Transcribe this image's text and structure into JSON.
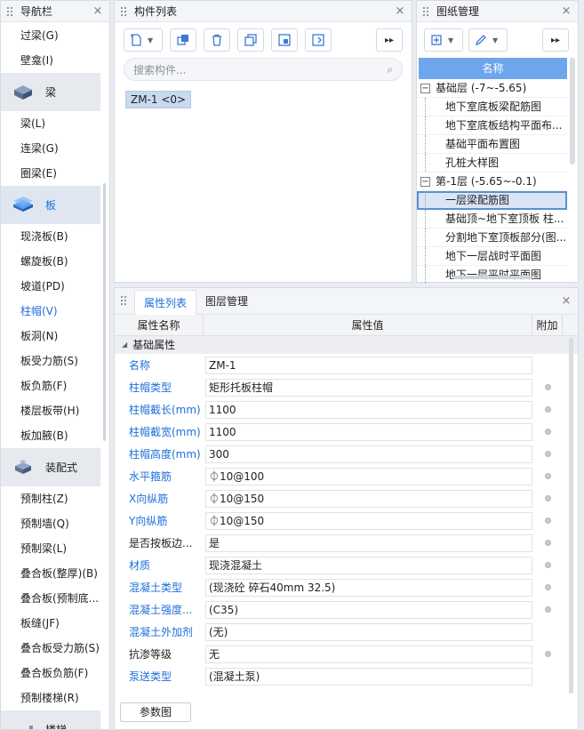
{
  "nav": {
    "title": "导航栏",
    "close": "×",
    "items": [
      {
        "kind": "item",
        "label": "过梁(G)"
      },
      {
        "kind": "item",
        "label": "壁龛(I)"
      },
      {
        "kind": "cat",
        "label": "梁",
        "icon": "beam-icon"
      },
      {
        "kind": "item",
        "label": "梁(L)"
      },
      {
        "kind": "item",
        "label": "连梁(G)"
      },
      {
        "kind": "item",
        "label": "圈梁(E)"
      },
      {
        "kind": "cat",
        "label": "板",
        "icon": "slab-icon",
        "selected": true
      },
      {
        "kind": "item",
        "label": "现浇板(B)"
      },
      {
        "kind": "item",
        "label": "螺旋板(B)"
      },
      {
        "kind": "item",
        "label": "坡道(PD)"
      },
      {
        "kind": "item",
        "label": "柱帽(V)",
        "active": true
      },
      {
        "kind": "item",
        "label": "板洞(N)"
      },
      {
        "kind": "item",
        "label": "板受力筋(S)"
      },
      {
        "kind": "item",
        "label": "板负筋(F)"
      },
      {
        "kind": "item",
        "label": "楼层板带(H)"
      },
      {
        "kind": "item",
        "label": "板加腋(B)"
      },
      {
        "kind": "cat",
        "label": "装配式",
        "icon": "prefab-icon"
      },
      {
        "kind": "item",
        "label": "预制柱(Z)"
      },
      {
        "kind": "item",
        "label": "预制墙(Q)"
      },
      {
        "kind": "item",
        "label": "预制梁(L)"
      },
      {
        "kind": "item",
        "label": "叠合板(整厚)(B)"
      },
      {
        "kind": "item",
        "label": "叠合板(预制底..."
      },
      {
        "kind": "item",
        "label": "板缝(JF)"
      },
      {
        "kind": "item",
        "label": "叠合板受力筋(S)"
      },
      {
        "kind": "item",
        "label": "叠合板负筋(F)"
      },
      {
        "kind": "item",
        "label": "预制楼梯(R)"
      },
      {
        "kind": "cat",
        "label": "楼梯",
        "icon": "stairs-icon"
      }
    ]
  },
  "complist": {
    "title": "构件列表",
    "close": "×",
    "search_placeholder": "搜索构件...",
    "more": "▸▸",
    "component": "ZM-1 <0>"
  },
  "drawings": {
    "title": "图纸管理",
    "close": "×",
    "more": "▸▸",
    "column_header": "名称",
    "rows": [
      {
        "type": "group",
        "label": "基础层 (-7~-5.65)",
        "toggle": "−"
      },
      {
        "type": "child",
        "label": "地下室底板梁配筋图"
      },
      {
        "type": "child",
        "label": "地下室底板结构平面布..."
      },
      {
        "type": "child",
        "label": "基础平面布置图"
      },
      {
        "type": "child",
        "label": "孔桩大样图"
      },
      {
        "type": "group",
        "label": "第-1层 (-5.65~-0.1)",
        "toggle": "−"
      },
      {
        "type": "child",
        "label": "一层梁配筋图",
        "selected": true
      },
      {
        "type": "child",
        "label": "基础顶~地下室顶板 柱..."
      },
      {
        "type": "child",
        "label": "分割地下室顶板部分(图..."
      },
      {
        "type": "child",
        "label": "地下一层战时平面图"
      },
      {
        "type": "child",
        "label": "地下一层平时平面图"
      }
    ]
  },
  "props": {
    "tabs": [
      "属性列表",
      "图层管理"
    ],
    "close": "×",
    "headers": {
      "name": "属性名称",
      "value": "属性值",
      "add": "附加"
    },
    "section": "基础属性",
    "rows": [
      {
        "name": "名称",
        "value": "ZM-1",
        "blue": true,
        "dot": false
      },
      {
        "name": "柱帽类型",
        "value": "矩形托板柱帽",
        "blue": true,
        "dot": true
      },
      {
        "name": "柱帽截长(mm)",
        "value": "1100",
        "blue": true,
        "dot": true
      },
      {
        "name": "柱帽截宽(mm)",
        "value": "1100",
        "blue": true,
        "dot": true
      },
      {
        "name": "柱帽高度(mm)",
        "value": "300",
        "blue": true,
        "dot": true
      },
      {
        "name": "水平箍筋",
        "value": "⏀10@100",
        "blue": true,
        "dot": true
      },
      {
        "name": "X向纵筋",
        "value": "⏀10@150",
        "blue": true,
        "dot": true
      },
      {
        "name": "Y向纵筋",
        "value": "⏀10@150",
        "blue": true,
        "dot": true
      },
      {
        "name": "是否按板边...",
        "value": "是",
        "blue": false,
        "dot": true
      },
      {
        "name": "材质",
        "value": "现浇混凝土",
        "blue": true,
        "dot": true
      },
      {
        "name": "混凝土类型",
        "value": "(现浇砼 碎石40mm 32.5)",
        "blue": true,
        "dot": true
      },
      {
        "name": "混凝土强度...",
        "value": "(C35)",
        "blue": true,
        "dot": true
      },
      {
        "name": "混凝土外加剂",
        "value": "(无)",
        "blue": true,
        "dot": false
      },
      {
        "name": "抗渗等级",
        "value": "无",
        "blue": false,
        "dot": true
      },
      {
        "name": "泵送类型",
        "value": "(混凝土泵)",
        "blue": true,
        "dot": false
      }
    ],
    "footer_button": "参数图"
  }
}
